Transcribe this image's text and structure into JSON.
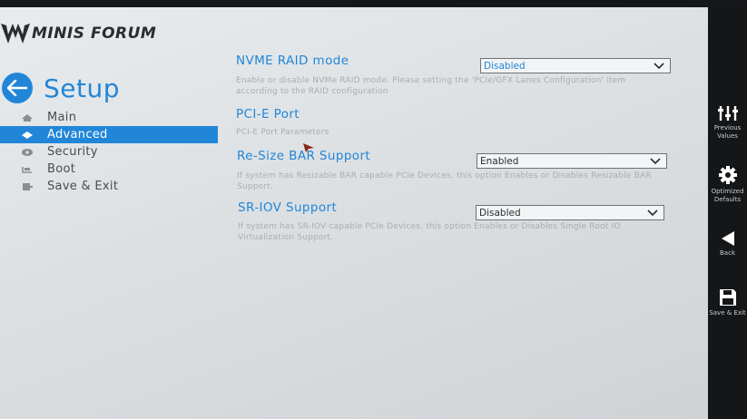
{
  "brand": {
    "logo_text": "MINIS FORUM"
  },
  "header": {
    "title": "Setup"
  },
  "nav": {
    "items": [
      {
        "label": "Main",
        "icon": "home-icon"
      },
      {
        "label": "Advanced",
        "icon": "advanced-icon"
      },
      {
        "label": "Security",
        "icon": "security-icon"
      },
      {
        "label": "Boot",
        "icon": "boot-icon"
      },
      {
        "label": "Save & Exit",
        "icon": "save-exit-icon"
      }
    ],
    "active_index": 1
  },
  "options": [
    {
      "title": "NVME RAID mode",
      "description": "Enable or disable NVMe RAID mode. Please setting the 'PCIe/GFX Lanes Configuration' item according to the RAID configuration",
      "value": "Disabled"
    },
    {
      "title": "PCI-E Port",
      "description": "PCI-E Port Parameters",
      "value": null
    },
    {
      "title": "Re-Size BAR Support",
      "description": "If system has Resizable BAR capable PCIe Devices, this option Enables or Disables Resizable BAR Support.",
      "value": "Enabled"
    },
    {
      "title": "SR-IOV Support",
      "description": "If system has SR-IOV capable PCIe Devices, this option Enables or Disables Single Root IO Virtualization Support.",
      "value": "Disabled"
    }
  ],
  "side_panel": {
    "items": [
      {
        "label": "Previous Values",
        "icon": "sliders-icon"
      },
      {
        "label": "Optimized Defaults",
        "icon": "gear-icon"
      },
      {
        "label": "Back",
        "icon": "back-triangle-icon"
      },
      {
        "label": "Save & Exit",
        "icon": "floppy-disk-icon"
      }
    ]
  },
  "colors": {
    "accent": "#2286d8",
    "background": "#e3e6e8",
    "panel": "#141618"
  }
}
